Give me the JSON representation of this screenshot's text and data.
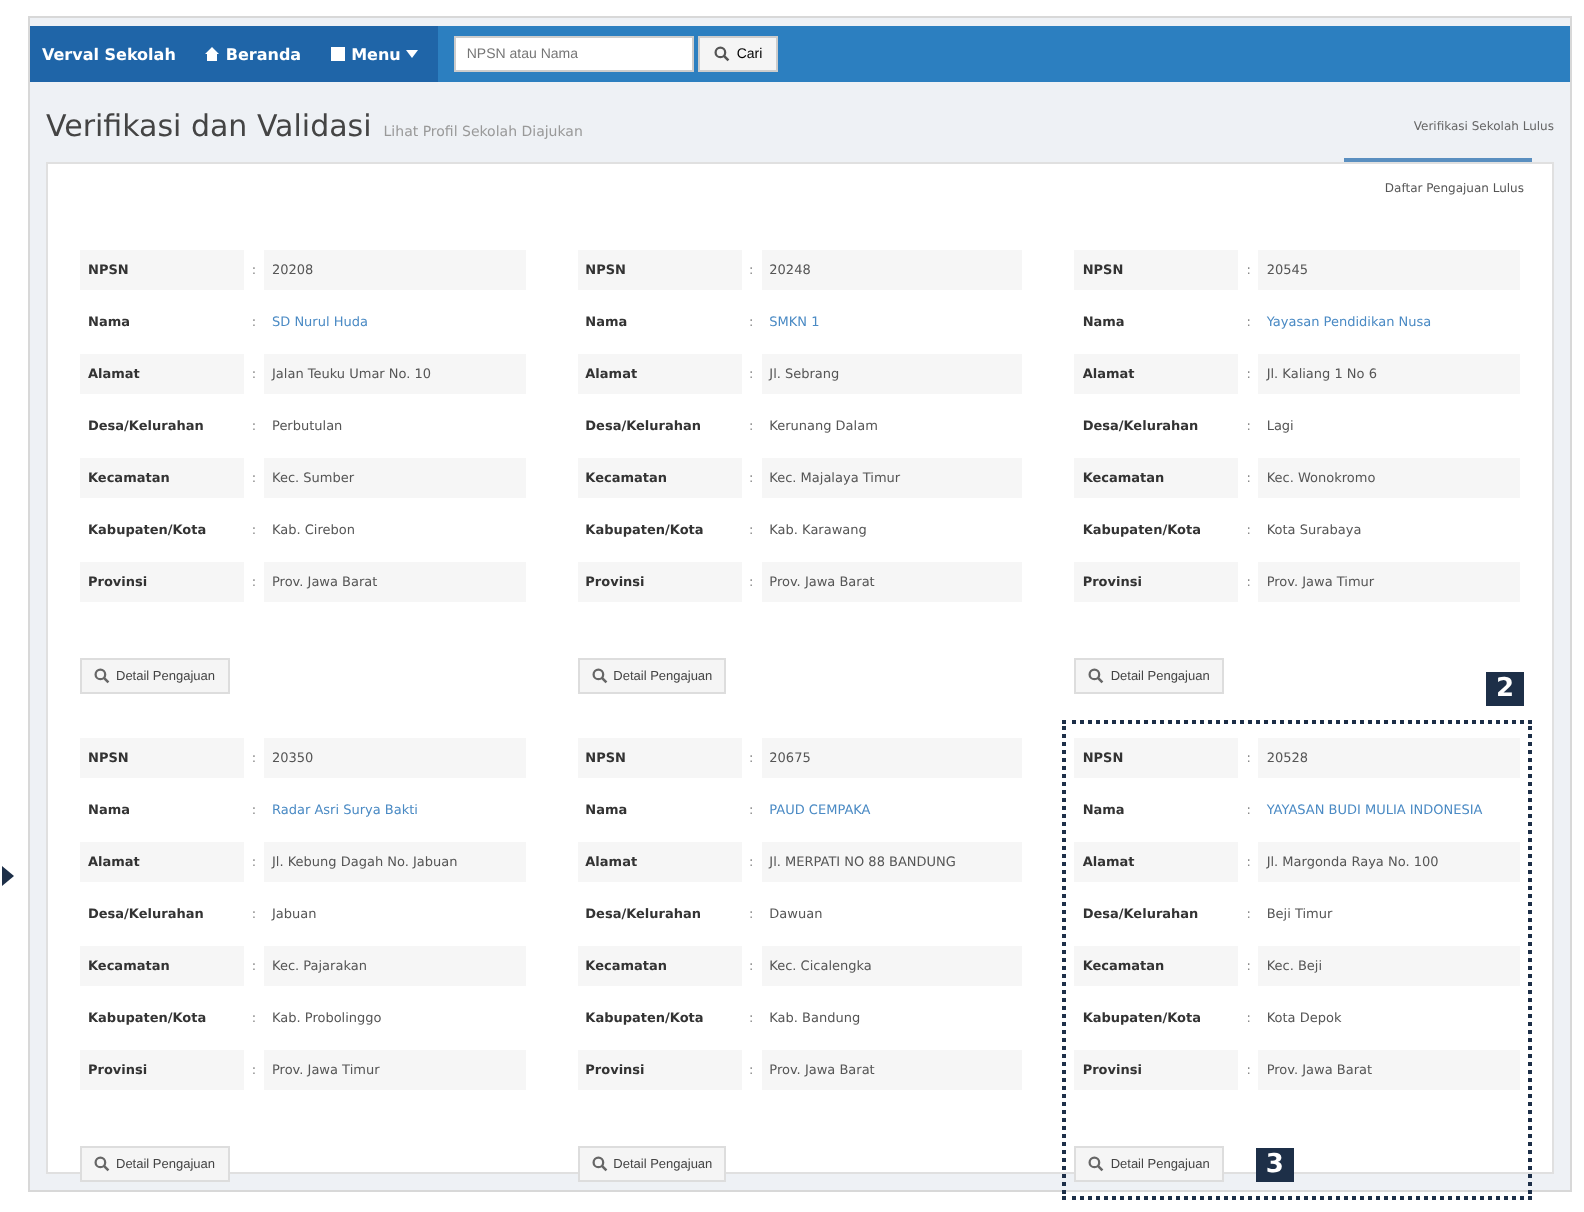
{
  "navbar": {
    "brand": "Verval Sekolah",
    "items": [
      {
        "label": "Beranda",
        "kind": "link"
      },
      {
        "label": "Menu",
        "kind": "dropdown"
      }
    ],
    "search": {
      "placeholder": "NPSN atau Nama",
      "button": "Cari"
    }
  },
  "header": {
    "title": "Verifikasi dan Validasi",
    "subtitle": "Lihat Profil Sekolah Diajukan",
    "link": "Verifikasi Sekolah Lulus"
  },
  "tab": {
    "label": "Daftar Pengajuan Lulus"
  },
  "cards": [
    {
      "fields": [
        {
          "label": "NPSN",
          "sep": ":",
          "value": "20208"
        },
        {
          "label": "Nama",
          "sep": ":",
          "value": "SD Nurul Huda"
        },
        {
          "label": "Alamat",
          "sep": ":",
          "value": "Jalan Teuku Umar No. 10"
        },
        {
          "label": "Desa/Kelurahan",
          "sep": ":",
          "value": "Perbutulan"
        },
        {
          "label": "Kecamatan",
          "sep": ":",
          "value": "Kec. Sumber"
        },
        {
          "label": "Kabupaten/Kota",
          "sep": ":",
          "value": "Kab. Cirebon"
        },
        {
          "label": "Provinsi",
          "sep": ":",
          "value": "Prov. Jawa Barat"
        }
      ],
      "button": "Detail Pengajuan",
      "highlighted": false
    },
    {
      "fields": [
        {
          "label": "NPSN",
          "sep": ":",
          "value": "20248"
        },
        {
          "label": "Nama",
          "sep": ":",
          "value": "SMKN 1"
        },
        {
          "label": "Alamat",
          "sep": ":",
          "value": "Jl. Sebrang"
        },
        {
          "label": "Desa/Kelurahan",
          "sep": ":",
          "value": "Kerunang Dalam"
        },
        {
          "label": "Kecamatan",
          "sep": ":",
          "value": "Kec. Majalaya Timur"
        },
        {
          "label": "Kabupaten/Kota",
          "sep": ":",
          "value": "Kab. Karawang"
        },
        {
          "label": "Provinsi",
          "sep": ":",
          "value": "Prov. Jawa Barat"
        }
      ],
      "button": "Detail Pengajuan",
      "highlighted": false
    },
    {
      "fields": [
        {
          "label": "NPSN",
          "sep": ":",
          "value": "20545"
        },
        {
          "label": "Nama",
          "sep": ":",
          "value": "Yayasan Pendidikan Nusa"
        },
        {
          "label": "Alamat",
          "sep": ":",
          "value": "Jl. Kaliang 1 No 6"
        },
        {
          "label": "Desa/Kelurahan",
          "sep": ":",
          "value": "Lagi"
        },
        {
          "label": "Kecamatan",
          "sep": ":",
          "value": "Kec. Wonokromo"
        },
        {
          "label": "Kabupaten/Kota",
          "sep": ":",
          "value": "Kota Surabaya"
        },
        {
          "label": "Provinsi",
          "sep": ":",
          "value": "Prov. Jawa Timur"
        }
      ],
      "button": "Detail Pengajuan",
      "highlighted": false
    },
    {
      "fields": [
        {
          "label": "NPSN",
          "sep": ":",
          "value": "20350"
        },
        {
          "label": "Nama",
          "sep": ":",
          "value": "Radar Asri Surya Bakti"
        },
        {
          "label": "Alamat",
          "sep": ":",
          "value": "Jl. Kebung Dagah No. Jabuan"
        },
        {
          "label": "Desa/Kelurahan",
          "sep": ":",
          "value": "Jabuan"
        },
        {
          "label": "Kecamatan",
          "sep": ":",
          "value": "Kec. Pajarakan"
        },
        {
          "label": "Kabupaten/Kota",
          "sep": ":",
          "value": "Kab. Probolinggo"
        },
        {
          "label": "Provinsi",
          "sep": ":",
          "value": "Prov. Jawa Timur"
        }
      ],
      "button": "Detail Pengajuan",
      "highlighted": false
    },
    {
      "fields": [
        {
          "label": "NPSN",
          "sep": ":",
          "value": "20675"
        },
        {
          "label": "Nama",
          "sep": ":",
          "value": "PAUD CEMPAKA"
        },
        {
          "label": "Alamat",
          "sep": ":",
          "value": "Jl. MERPATI NO 88 BANDUNG"
        },
        {
          "label": "Desa/Kelurahan",
          "sep": ":",
          "value": "Dawuan"
        },
        {
          "label": "Kecamatan",
          "sep": ":",
          "value": "Kec. Cicalengka"
        },
        {
          "label": "Kabupaten/Kota",
          "sep": ":",
          "value": "Kab. Bandung"
        },
        {
          "label": "Provinsi",
          "sep": ":",
          "value": "Prov. Jawa Barat"
        }
      ],
      "button": "Detail Pengajuan",
      "highlighted": false
    },
    {
      "fields": [
        {
          "label": "NPSN",
          "sep": ":",
          "value": "20528"
        },
        {
          "label": "Nama",
          "sep": ":",
          "value": "YAYASAN BUDI MULIA INDONESIA"
        },
        {
          "label": "Alamat",
          "sep": ":",
          "value": "Jl. Margonda Raya No. 100"
        },
        {
          "label": "Desa/Kelurahan",
          "sep": ":",
          "value": "Beji Timur"
        },
        {
          "label": "Kecamatan",
          "sep": ":",
          "value": "Kec. Beji"
        },
        {
          "label": "Kabupaten/Kota",
          "sep": ":",
          "value": "Kota Depok"
        },
        {
          "label": "Provinsi",
          "sep": ":",
          "value": "Prov. Jawa Barat"
        }
      ],
      "button": "Detail Pengajuan",
      "highlighted": true,
      "badges": [
        "2",
        "3"
      ]
    }
  ]
}
